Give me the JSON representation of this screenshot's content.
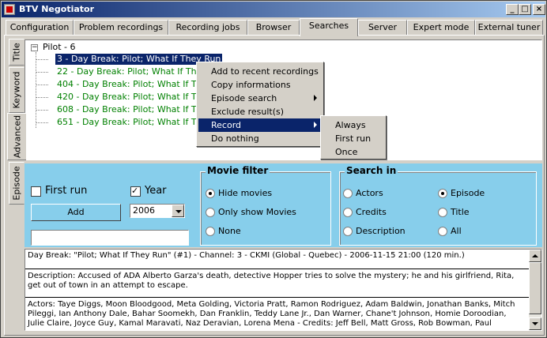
{
  "window": {
    "title": "BTV Negotiator",
    "minimize": "_",
    "maximize": "□",
    "close": "×"
  },
  "tabs_top": [
    "Configuration",
    "Problem recordings",
    "Recording jobs",
    "Browser",
    "Searches",
    "Server",
    "Expert mode",
    "External tuner"
  ],
  "tabs_side": [
    "Title",
    "Keyword",
    "Advanced",
    "Episode"
  ],
  "tree": {
    "root": "Pilot - 6",
    "items": [
      "3 - Day Break: Pilot; What If They Run",
      "22 - Day Break: Pilot; What If They Run",
      "404 - Day Break: Pilot; What If They Run",
      "420 - Day Break: Pilot; What If They Run",
      "608 - Day Break: Pilot; What If They Run",
      "651 - Day Break: Pilot; What If They Run"
    ]
  },
  "context_menu": {
    "items": [
      "Add to recent recordings",
      "Copy informations",
      "Episode search",
      "Exclude result(s)",
      "Record",
      "Do nothing"
    ],
    "submenu": [
      "Always",
      "First run",
      "Once"
    ]
  },
  "left_panel": {
    "first_run": "First run",
    "year": "Year",
    "add": "Add",
    "year_value": "2006",
    "text_value": ""
  },
  "movie_filter": {
    "title": "Movie filter",
    "options": [
      "Hide movies",
      "Only show Movies",
      "None"
    ]
  },
  "search_in": {
    "title": "Search in",
    "options": [
      "Actors",
      "Credits",
      "Description",
      "Episode",
      "Title",
      "All"
    ]
  },
  "details": {
    "line1": "Day Break: \"Pilot; What If They Run\" (#1) - Channel: 3 - CKMI (Global - Quebec) - 2006-11-15 21:00 (120 min.)",
    "description": "Description: Accused of ADA Alberto Garza's death, detective Hopper tries to solve the mystery; he and his girlfriend, Rita, get out of town in an attempt to escape.",
    "actors": "Actors: Taye Diggs, Moon Bloodgood, Meta Golding, Victoria Pratt, Ramon Rodriguez, Adam Baldwin, Jonathan Banks, Mitch Pileggi, Ian Anthony Dale, Bahar Soomekh, Dan Franklin, Teddy Lane Jr., Dan Warner, Chane't Johnson, Homie Doroodian, Julie Claire, Joyce Guy, Kamal Maravati, Naz Deravian, Lorena Mena - Credits: Jeff Bell, Matt Gross, Rob Bowman, Paul"
  }
}
